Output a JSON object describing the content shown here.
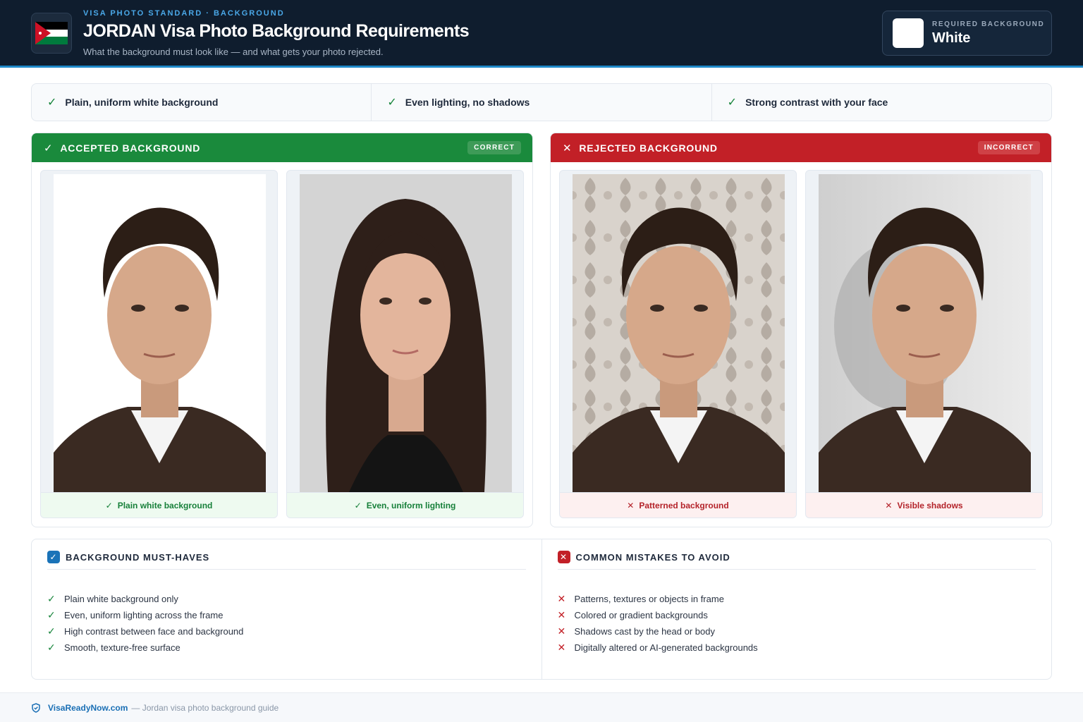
{
  "header": {
    "eyebrow": "VISA PHOTO STANDARD · BACKGROUND",
    "title": "JORDAN Visa Photo Background Requirements",
    "subtitle": "What the background must look like — and what gets your photo rejected.",
    "flag_icon": "jordan-flag-icon",
    "required_label": "REQUIRED BACKGROUND",
    "required_value": "White",
    "required_color": "#FFFFFF"
  },
  "rules": [
    {
      "icon": "check-icon",
      "label": "Plain, uniform white background"
    },
    {
      "icon": "check-icon",
      "label": "Even lighting, no shadows"
    },
    {
      "icon": "check-icon",
      "label": "Strong contrast with your face"
    }
  ],
  "accepted": {
    "title": "ACCEPTED BACKGROUND",
    "badge": "CORRECT",
    "color": "#1A8A3C",
    "cards": [
      {
        "caption": "Plain white background",
        "icon": "check-icon"
      },
      {
        "caption": "Even, uniform lighting",
        "icon": "check-icon"
      }
    ]
  },
  "rejected": {
    "title": "REJECTED BACKGROUND",
    "badge": "INCORRECT",
    "color": "#C22027",
    "cards": [
      {
        "caption": "Patterned background",
        "icon": "cross-icon"
      },
      {
        "caption": "Visible shadows",
        "icon": "cross-icon"
      }
    ]
  },
  "must_haves": {
    "title": "BACKGROUND MUST-HAVES",
    "items": [
      "Plain white background only",
      "Even, uniform lighting across the frame",
      "High contrast between face and background",
      "Smooth, texture-free surface"
    ]
  },
  "mistakes": {
    "title": "COMMON MISTAKES TO AVOID",
    "items": [
      "Patterns, textures or objects in frame",
      "Colored or gradient backgrounds",
      "Shadows cast by the head or body",
      "Digitally altered or AI-generated backgrounds"
    ]
  },
  "footer": {
    "brand": "VisaReadyNow.com",
    "description": "— Jordan visa photo background guide"
  }
}
